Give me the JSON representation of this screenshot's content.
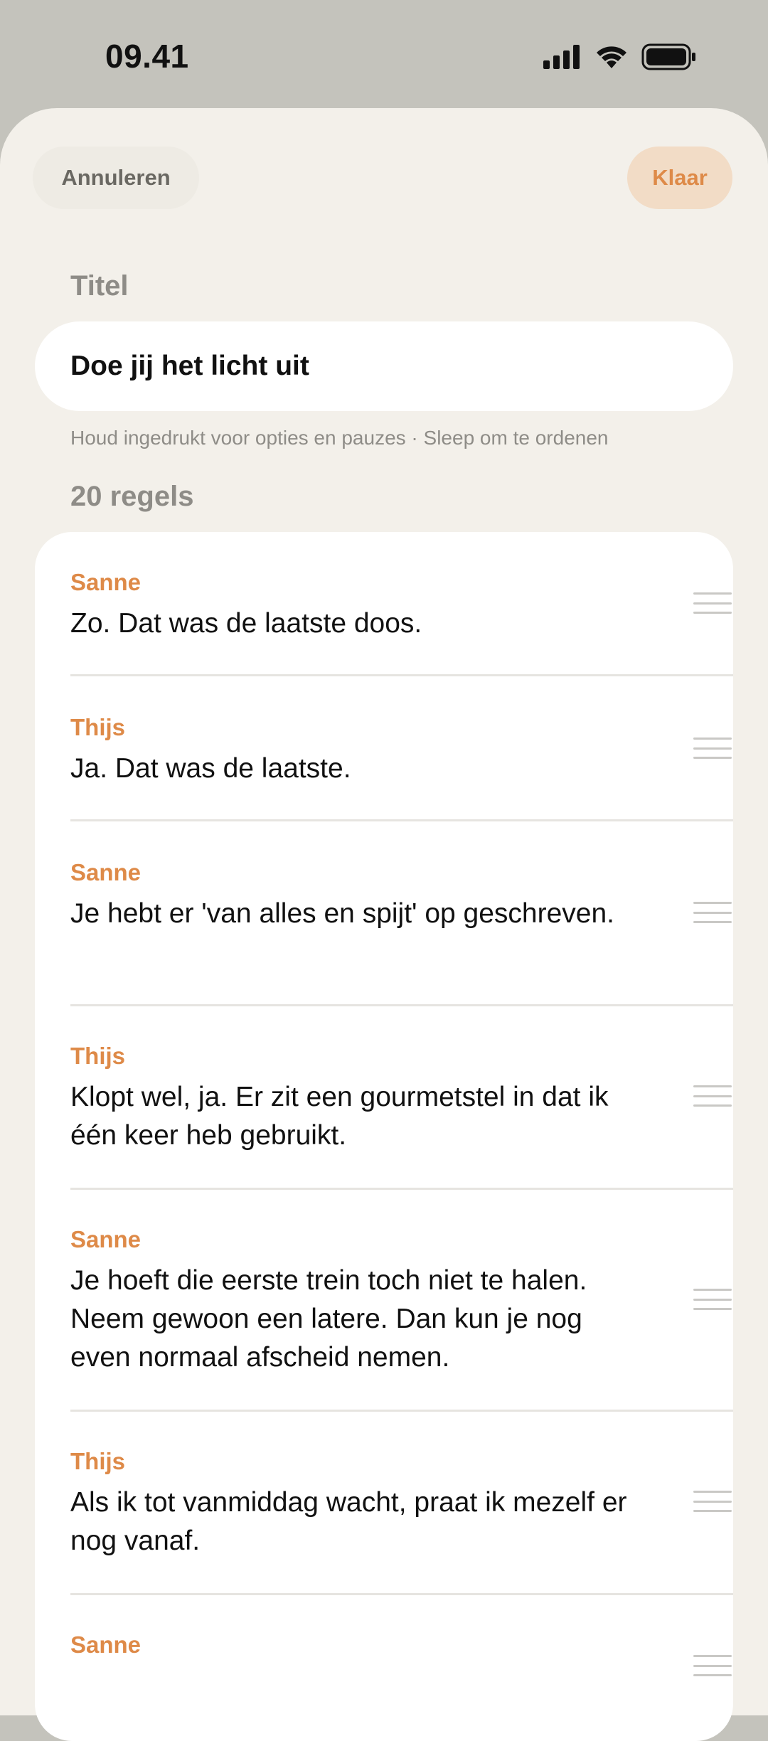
{
  "status_bar": {
    "time": "09.41",
    "icons": [
      "cellular-signal-icon",
      "wifi-icon",
      "battery-icon"
    ]
  },
  "header": {
    "cancel_label": "Annuleren",
    "done_label": "Klaar"
  },
  "title_section": {
    "label": "Titel",
    "value": "Doe jij het licht uit"
  },
  "hint": "Houd ingedrukt voor opties en pauzes · Sleep om te ordenen",
  "lines_section": {
    "count_label": "20 regels",
    "lines": [
      {
        "speaker": "Sanne",
        "text": "Zo. Dat was de laatste doos."
      },
      {
        "speaker": "Thijs",
        "text": "Ja. Dat was de laatste."
      },
      {
        "speaker": "Sanne",
        "text": "Je hebt er 'van alles en spijt' op geschreven."
      },
      {
        "speaker": "Thijs",
        "text": "Klopt wel, ja. Er zit een gourmetstel in dat ik één keer heb gebruikt."
      },
      {
        "speaker": "Sanne",
        "text": "Je hoeft die eerste trein toch niet te halen. Neem gewoon een latere. Dan kun je nog even normaal afscheid nemen."
      },
      {
        "speaker": "Thijs",
        "text": "Als ik tot vanmiddag wacht, praat ik mezelf er nog vanaf."
      },
      {
        "speaker": "Sanne",
        "text": ""
      }
    ]
  },
  "colors": {
    "accent": "#de8a48",
    "background": "#f3f0ea",
    "status_bar_bg": "#c4c3bc"
  }
}
